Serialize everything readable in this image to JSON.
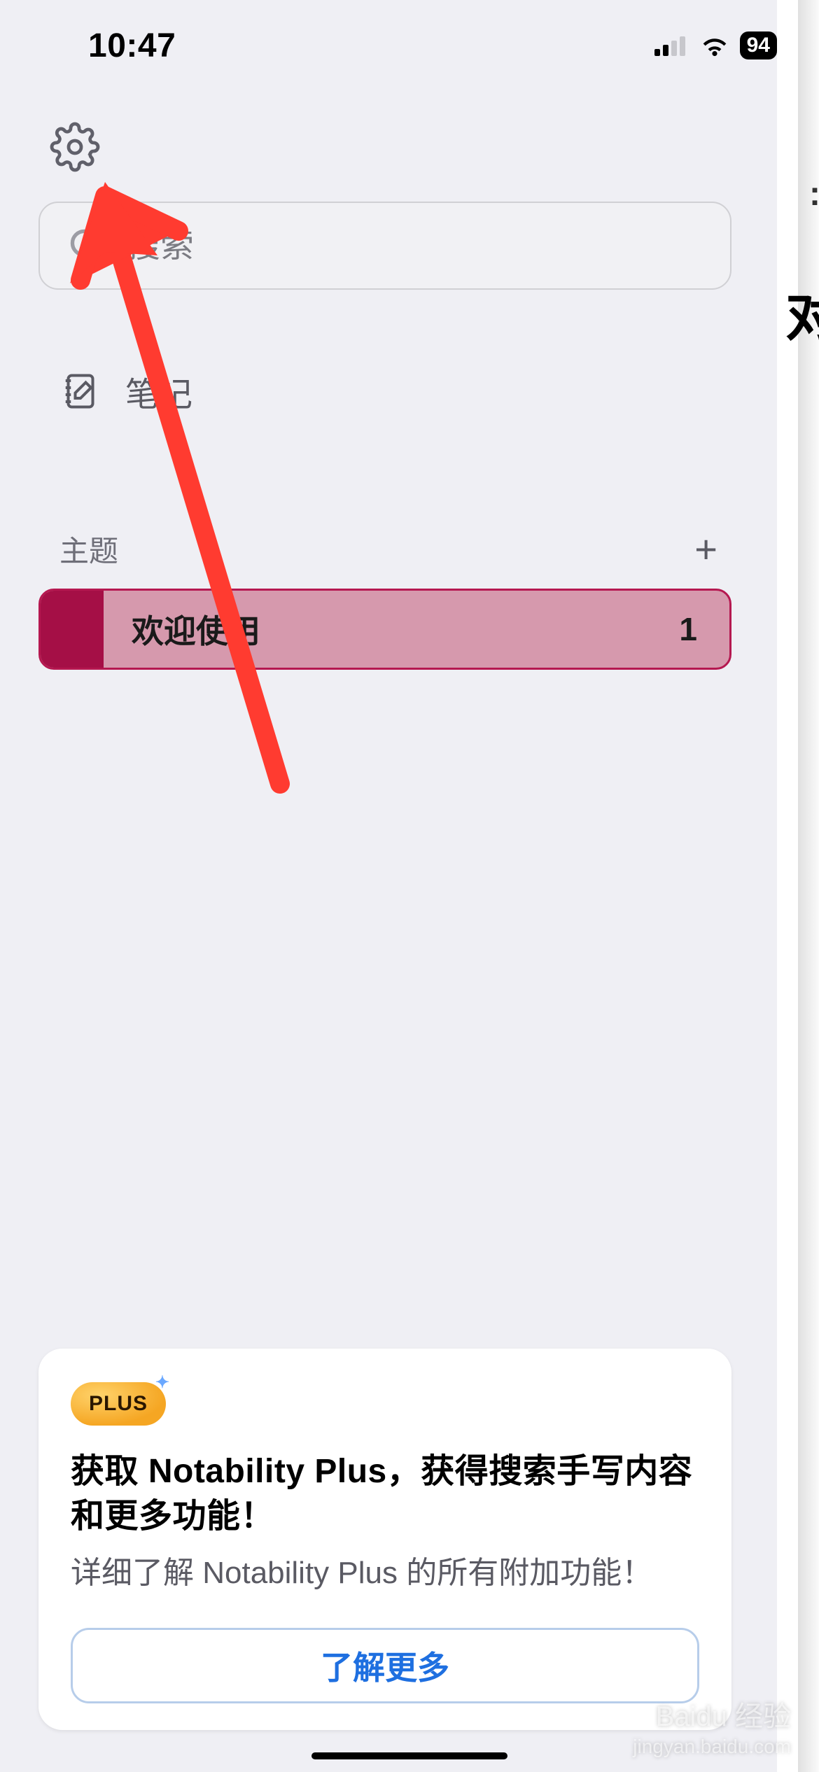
{
  "status": {
    "time": "10:47",
    "battery": "94"
  },
  "search": {
    "placeholder": "搜索"
  },
  "nav": {
    "notes_label": "笔记"
  },
  "subjects": {
    "header": "主题",
    "items": [
      {
        "name": "欢迎使用",
        "count": "1"
      }
    ]
  },
  "promo": {
    "badge": "PLUS",
    "title": "获取 Notability Plus，获得搜索手写内容和更多功能！",
    "subtitle": "详细了解 Notability Plus 的所有附加功能！",
    "cta": "了解更多"
  },
  "peek": {
    "char": "对"
  },
  "watermark": {
    "brand": "Baidu 经验",
    "sub": "jingyan.baidu.com"
  }
}
